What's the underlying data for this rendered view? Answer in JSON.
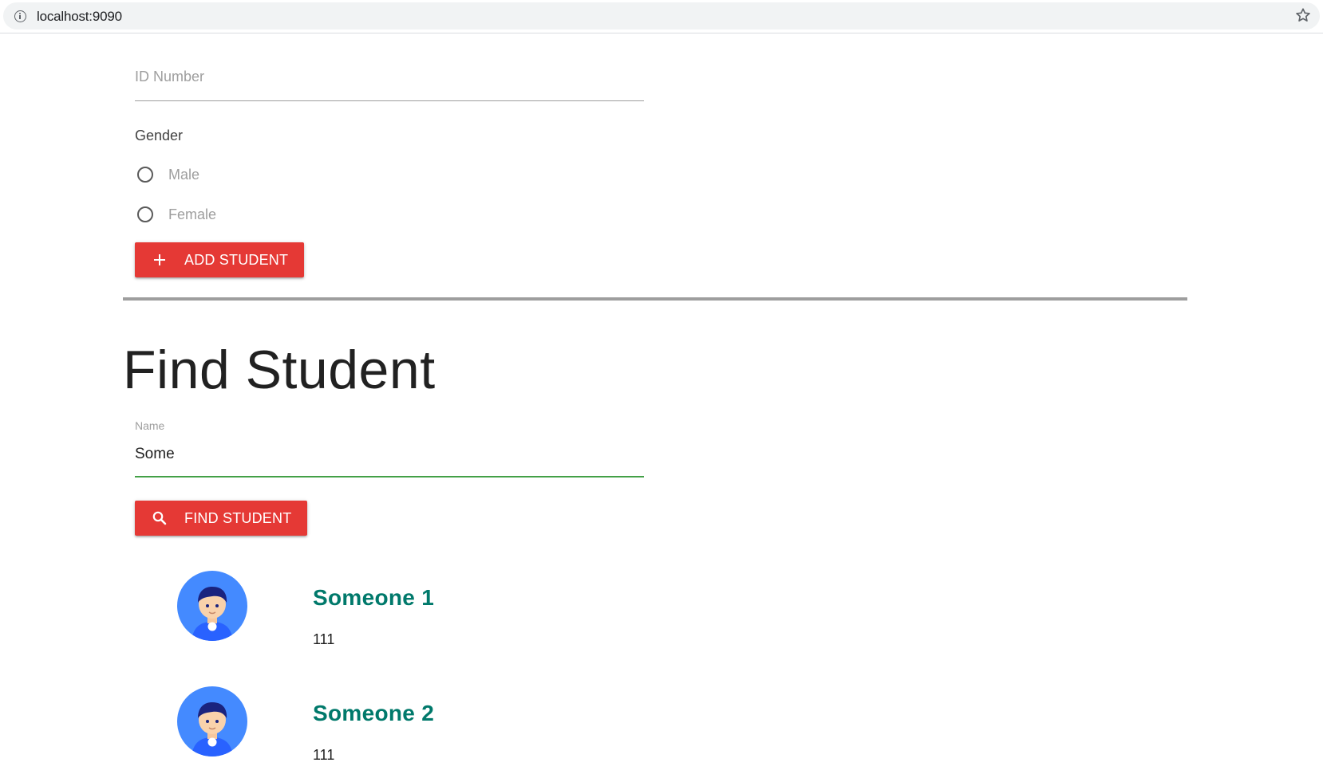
{
  "browser": {
    "url": "localhost:9090",
    "icons": {
      "site_info": "info-icon",
      "bookmark": "star-icon"
    }
  },
  "add_form": {
    "id_number_placeholder": "ID Number",
    "gender_label": "Gender",
    "gender_options": [
      "Male",
      "Female"
    ],
    "add_button_label": "ADD STUDENT",
    "add_button_icon": "plus-icon"
  },
  "find_section": {
    "title": "Find Student",
    "name_label": "Name",
    "name_value": "Some",
    "find_button_label": "FIND STUDENT",
    "find_button_icon": "search-icon"
  },
  "results": [
    {
      "name": "Someone 1",
      "id": "111",
      "avatar": "avatar-icon"
    },
    {
      "name": "Someone 2",
      "id": "111",
      "avatar": "avatar-icon"
    }
  ],
  "colors": {
    "primary_button": "#e53935",
    "result_name": "#00796b",
    "active_underline": "#43a047",
    "avatar_bg": "#448aff"
  }
}
